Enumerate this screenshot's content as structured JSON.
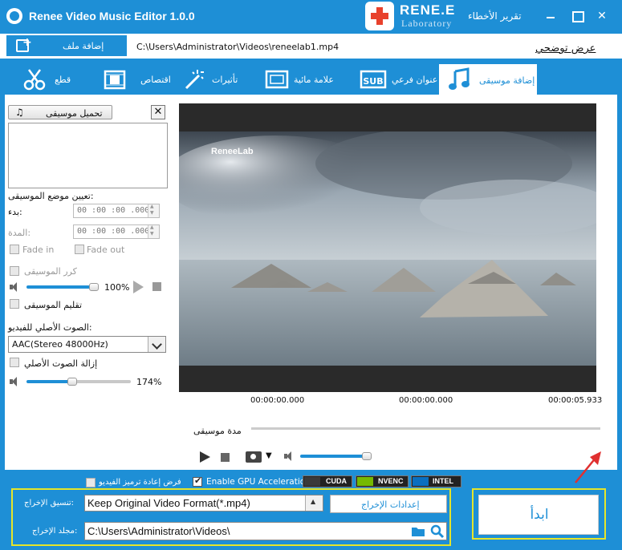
{
  "window": {
    "title": "Renee Video Music Editor 1.0.0",
    "brand_name": "RENE.E",
    "brand_sub": "Laboratory",
    "error_report": "تقرير الأخطاء",
    "close_glyph": "✕"
  },
  "filebar": {
    "add_file_label": "إضافة ملف",
    "file_path": "C:\\Users\\Administrator\\Videos\\reneelab1.mp4",
    "tutorial_link": "عرض توضحي"
  },
  "tabs": [
    {
      "label": "قطع",
      "icon": "scissors-icon"
    },
    {
      "label": "اقتصاص",
      "icon": "crop-icon"
    },
    {
      "label": "تأثيرات",
      "icon": "magic-wand-icon"
    },
    {
      "label": "علامة مائية",
      "icon": "watermark-icon"
    },
    {
      "label": "عنوان فرعي",
      "icon": "subtitle-icon"
    },
    {
      "label": "إضافة موسيقى",
      "icon": "music-note-icon",
      "active": true
    }
  ],
  "music_panel": {
    "load_music_label": "تحميل موسيقى",
    "close_glyph": "✕",
    "set_position_label": "تعيين موضع الموسيقى:",
    "start_label": "بدء:",
    "start_value": "00 :00 :00 .000",
    "duration_label": "المدة:",
    "duration_value": "00 :00 :00 .000",
    "fade_in_label": "Fade in",
    "fade_out_label": "Fade out",
    "repeat_label": "كرر الموسيقى",
    "music_volume_percent": 100,
    "music_volume_text": "100%",
    "trim_music_label": "تقليم الموسيقى",
    "original_audio_label": "الصوت الأصلي للفيديو:",
    "original_audio_value": "AAC(Stereo 48000Hz)",
    "remove_original_label": "إزالة الصوت الأصلي",
    "original_volume_percent": 174,
    "original_volume_text": "174%"
  },
  "player": {
    "watermark_text": "ReneeLab",
    "time_start": "00:00:00.000",
    "time_current": "00:00:00.000",
    "time_end": "00:00:05.933",
    "music_duration_label": "مدة موسيقى",
    "camera_arrow": "▼"
  },
  "bottom": {
    "reencode_label": "فرض إعادة ترميز الفيديو",
    "gpu_label": "Enable GPU Acceleration",
    "gpu_enabled": true,
    "badges": [
      "CUDA",
      "NVENC",
      "INTEL"
    ],
    "format_label": "تنسيق الإخراج:",
    "format_value": "Keep Original Video Format(*.mp4)",
    "output_settings_label": "إعدادات الإخراج",
    "folder_label": "مجلد الإخراج:",
    "folder_value": "C:\\Users\\Administrator\\Videos\\",
    "start_label": "ابدأ"
  },
  "colors": {
    "accent": "#1e8fd6",
    "highlight_box": "#e5e52a",
    "arrow": "#e03030"
  }
}
